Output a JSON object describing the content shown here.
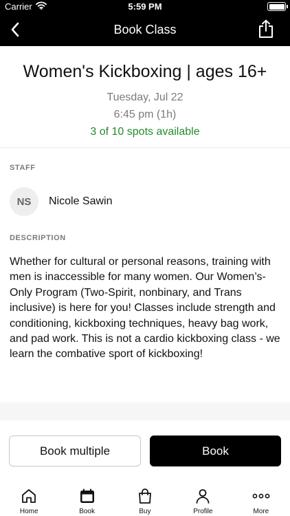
{
  "status": {
    "carrier": "Carrier",
    "time": "5:59 PM"
  },
  "nav": {
    "title": "Book Class"
  },
  "class": {
    "title": "Women's Kickboxing | ages 16+",
    "date": "Tuesday, Jul 22",
    "time": "6:45 pm (1h)",
    "spots": "3 of 10 spots available"
  },
  "staff": {
    "label": "STAFF",
    "initials": "NS",
    "name": "Nicole Sawin"
  },
  "description": {
    "label": "DESCRIPTION",
    "text": "Whether for cultural or personal reasons, training with men is inaccessible for many women. Our Women’s-Only Program (Two-Spirit, nonbinary, and Trans inclusive) is here for you! Classes include strength and conditioning, kickboxing techniques, heavy bag work, and pad work. This is not a cardio kickboxing class - we learn the combative sport of kickboxing!"
  },
  "actions": {
    "book_multiple": "Book multiple",
    "book": "Book"
  },
  "tabs": [
    {
      "label": "Home",
      "icon": "home-icon"
    },
    {
      "label": "Book",
      "icon": "calendar-icon"
    },
    {
      "label": "Buy",
      "icon": "bag-icon"
    },
    {
      "label": "Profile",
      "icon": "person-icon"
    },
    {
      "label": "More",
      "icon": "more-icon"
    }
  ],
  "colors": {
    "accent": "#000000",
    "spots_available": "#218a2c",
    "muted": "#7b7b7b"
  }
}
